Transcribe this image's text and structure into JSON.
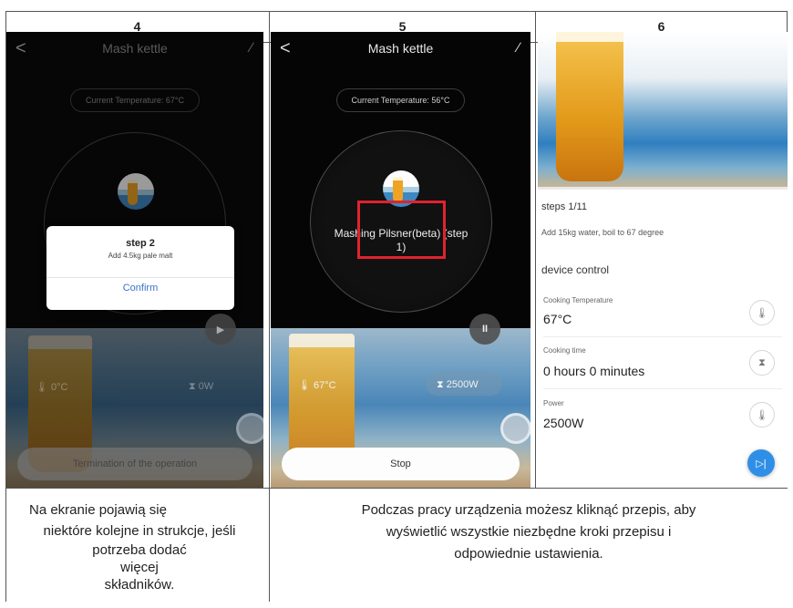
{
  "headers": [
    "4",
    "5",
    "6"
  ],
  "screen4": {
    "title": "Mash kettle",
    "back": "<",
    "current_temperature": "Current Temperature: 67°C",
    "dialog": {
      "title": "step 2",
      "text": "Add 4.5kg pale malt",
      "confirm": "Confirm"
    },
    "temperature": "0°C",
    "power": "0W",
    "bottom_button": "Termination of the operation"
  },
  "screen5": {
    "title": "Mash kettle",
    "back": "<",
    "current_temperature": "Current Temperature: 56°C",
    "recipe_line1": "Mashing Pilsner(beta) (step",
    "recipe_line2": "1)",
    "temperature": "67°C",
    "power": "2500W",
    "bottom_button": "Stop"
  },
  "screen6": {
    "steps": "steps 1/11",
    "step_text": "Add 15kg water, boil to 67 degree",
    "section": "device control",
    "controls": [
      {
        "label": "Cooking Temperature",
        "value": "67°C",
        "icon": "thermometer-icon"
      },
      {
        "label": "Cooking time",
        "value": "0 hours 0 minutes",
        "icon": "hourglass-icon"
      },
      {
        "label": "Power",
        "value": "2500W",
        "icon": "thermometer-icon"
      }
    ]
  },
  "captions": {
    "left": [
      "Na ekranie pojawią się",
      "niektóre kolejne in strukcje, jeśli",
      "potrzeba dodać",
      "więcej",
      "składników."
    ],
    "right": [
      "Podczas pracy urządzenia możesz kliknąć przepis, aby",
      "wyświetlić wszystkie niezbędne kroki przepisu i",
      "odpowiednie ustawienia."
    ]
  },
  "colors": {
    "highlight_box": "#e0232e",
    "confirm_text": "#3b73c8",
    "next_button": "#2f8fe6"
  }
}
